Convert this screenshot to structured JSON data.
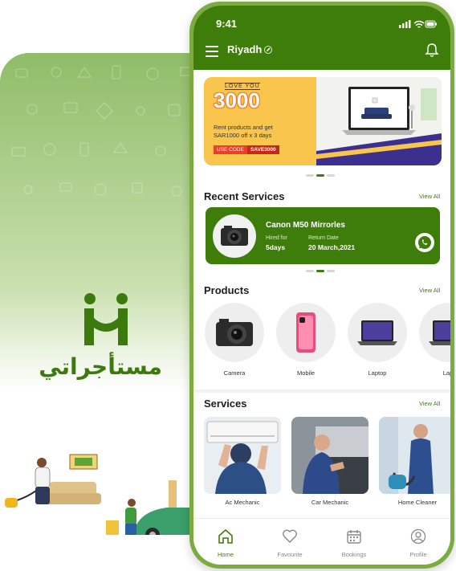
{
  "splash": {
    "logo_text": "مستأجراتي",
    "logo_glyph": "M-mark",
    "colors": {
      "brand": "#3d7a0e",
      "gradient_top": "#8fbd68"
    }
  },
  "status_bar": {
    "time": "9:41",
    "icons": [
      "signal-icon",
      "wifi-icon",
      "battery-icon"
    ]
  },
  "header": {
    "city": "Riyadh",
    "icons": [
      "menu-icon",
      "edit-icon",
      "bell-icon"
    ],
    "color": "#3f7d0b"
  },
  "banner": {
    "tagline": "LOVE YOU",
    "amount": "3000",
    "line1": "Rent products and get",
    "line2": "SAR1000 off x 3 days",
    "code_label": "USE CODE",
    "code": "SAVE3000",
    "slides": 3,
    "active_slide": 2
  },
  "recent_services": {
    "title": "Recent Services",
    "view_all": "View All",
    "item": {
      "name": "Canon M50 Mirrorles",
      "hired_label": "Hired for",
      "hired_value": "5days",
      "return_label": "Return Date",
      "return_value": "20 March,2021",
      "action_icon": "whatsapp-icon"
    },
    "slides": 3,
    "active_slide": 2
  },
  "products": {
    "title": "Products",
    "view_all": "View All",
    "items": [
      {
        "label": "Camera",
        "icon": "camera"
      },
      {
        "label": "Mobile",
        "icon": "smartphone"
      },
      {
        "label": "Laptop",
        "icon": "laptop"
      },
      {
        "label": "Lapt",
        "icon": "laptop"
      }
    ]
  },
  "services": {
    "title": "Services",
    "view_all": "View All",
    "items": [
      {
        "label": "Ac Mechanic"
      },
      {
        "label": "Car Mechanic"
      },
      {
        "label": "Home Cleaner"
      }
    ]
  },
  "tabbar": {
    "items": [
      {
        "label": "Home",
        "icon": "home-icon",
        "active": true
      },
      {
        "label": "Favourite",
        "icon": "heart-icon",
        "active": false
      },
      {
        "label": "Bookings",
        "icon": "calendar-icon",
        "active": false
      },
      {
        "label": "Profile",
        "icon": "user-icon",
        "active": false
      }
    ]
  }
}
